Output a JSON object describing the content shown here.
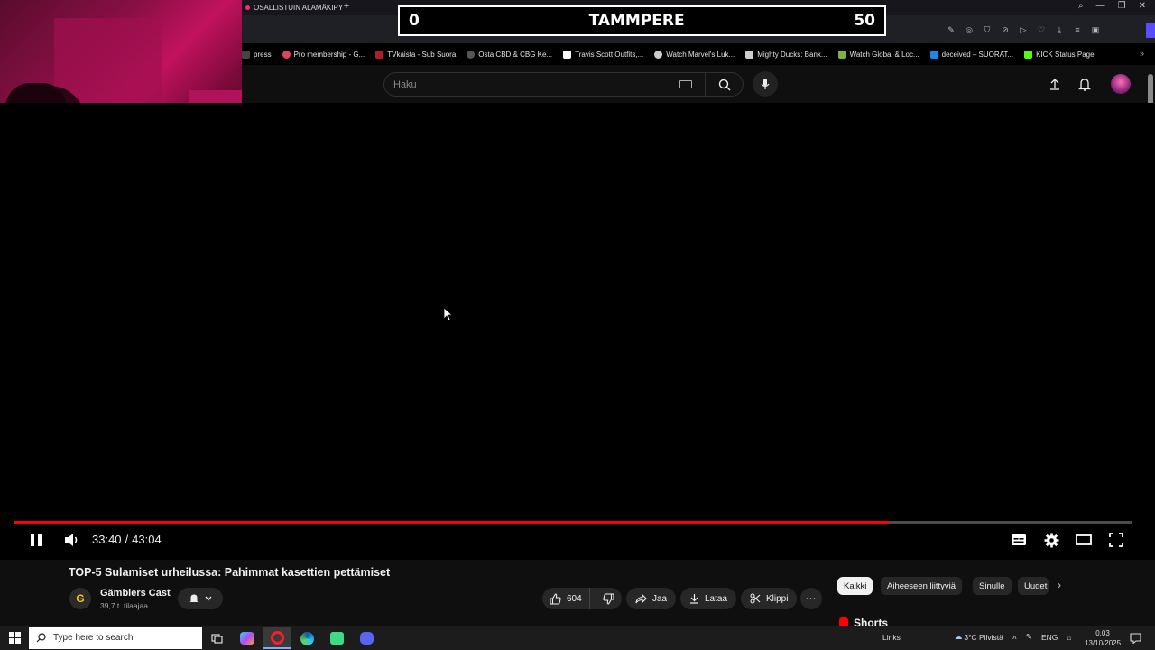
{
  "browser": {
    "active_tab_title": "OSALLISTUIN ALAMÄKIPY",
    "new_tab_icon": "plus-icon",
    "window_controls": [
      "search-icon",
      "minimize-icon",
      "restore-icon",
      "close-icon"
    ],
    "bookmarks": [
      {
        "label": "press",
        "color": "#444444"
      },
      {
        "label": "Pro membership - G...",
        "color": "#e2445c"
      },
      {
        "label": "TVkaista - Sub Suora",
        "color": "#b01c2e"
      },
      {
        "label": "Osta CBD & CBG Ke...",
        "color": "#555555"
      },
      {
        "label": "Travis Scott Outfits,...",
        "color": "#ffffff"
      },
      {
        "label": "Watch Marvel's Luk...",
        "color": "#cccccc"
      },
      {
        "label": "Mighty Ducks: Bank...",
        "color": "#cccccc"
      },
      {
        "label": "Watch Global & Loc...",
        "color": "#7cb342"
      },
      {
        "label": "deceived – SUORAT...",
        "color": "#1e88e5"
      },
      {
        "label": "KICK Status Page",
        "color": "#53fc18"
      }
    ]
  },
  "scoreboard": {
    "left": "0",
    "center": "TAMMPERE",
    "right": "50"
  },
  "youtube": {
    "search_placeholder": "Haku",
    "player": {
      "current_time": "33:40",
      "separator": "/",
      "duration": "43:04",
      "progress_fraction": 0.782,
      "buffer_fraction": 0.782,
      "accent_color": "#ff0000"
    },
    "video": {
      "title": "TOP-5 Sulamiset urheilussa: Pahimmat kasettien pettämiset",
      "channel_name": "Gämblers Cast",
      "subscribers": "39,7 t. tilaajaa",
      "channel_initial": "G",
      "likes": "604",
      "share_label": "Jaa",
      "download_label": "Lataa",
      "clip_label": "Klippi"
    },
    "chips": [
      "Kaikki",
      "Aiheeseen liittyviä",
      "Sinulle",
      "Uudet"
    ],
    "shorts_label": "Shorts"
  },
  "taskbar": {
    "search_placeholder": "Type here to search",
    "links_label": "Links",
    "weather": "3°C  Pilvistä",
    "language": "ENG",
    "time": "0.03",
    "date": "13/10/2025"
  }
}
